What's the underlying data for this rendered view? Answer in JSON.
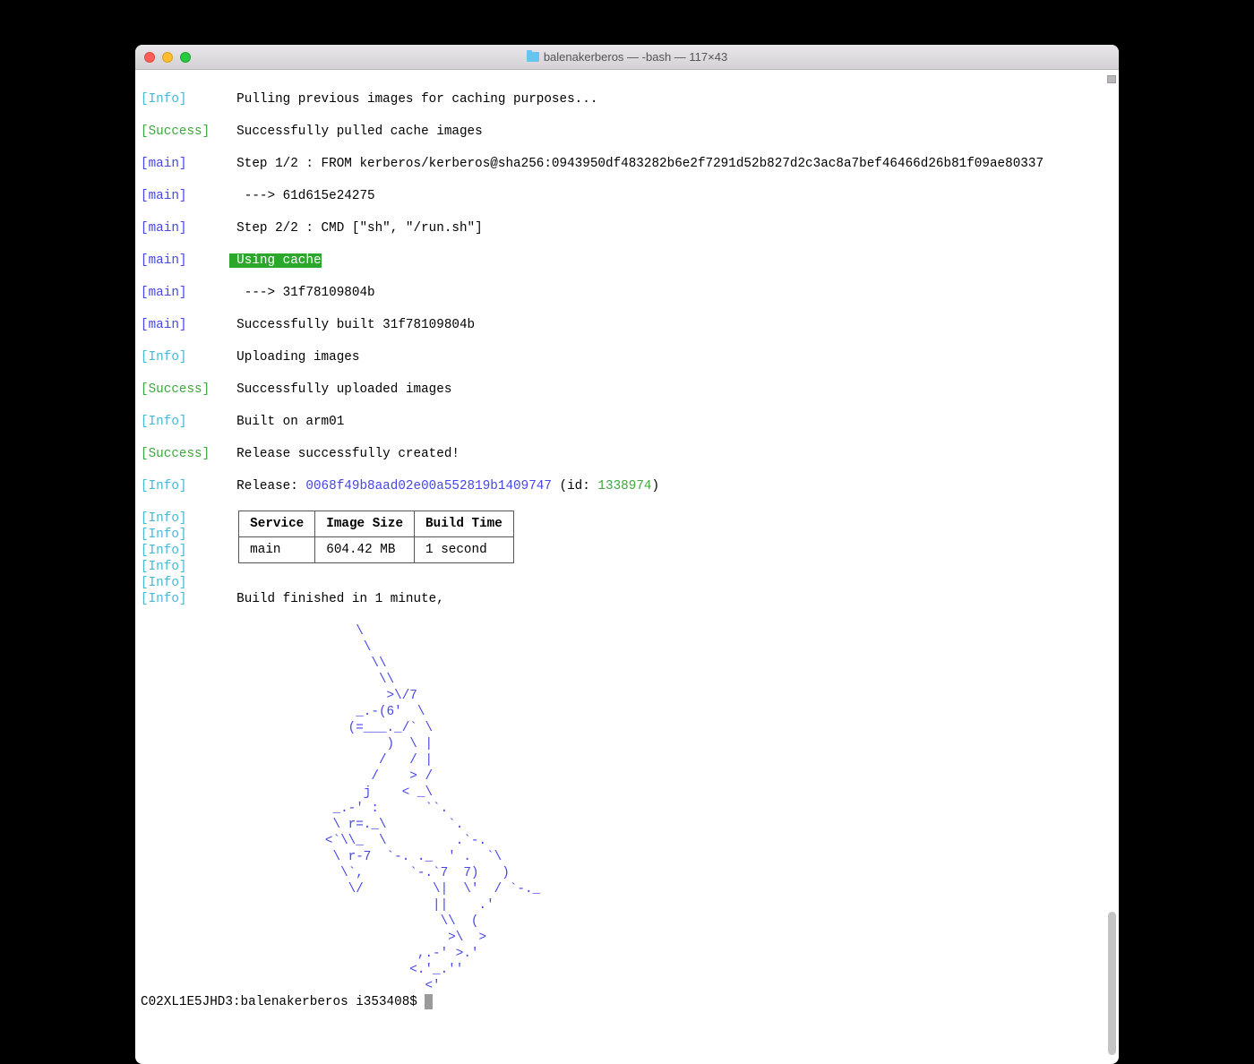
{
  "window": {
    "title": "balenakerberos — -bash — 117×43"
  },
  "tags": {
    "info": "[Info]",
    "success": "[Success]",
    "main": "[main]"
  },
  "lines": {
    "pulling": "Pulling previous images for caching purposes...",
    "pulled": "Successfully pulled cache images",
    "step1": "Step 1/2 : FROM kerberos/kerberos@sha256:0943950df483282b6e2f7291d52b827d2c3ac8a7bef46466d26b81f09ae80337",
    "arrow1": " ---> 61d615e24275",
    "step2": "Step 2/2 : CMD [\"sh\", \"/run.sh\"]",
    "usingcache": " Using cache",
    "arrow2": " ---> 31f78109804b",
    "built": "Successfully built 31f78109804b",
    "uploading": "Uploading images",
    "uploaded": "Successfully uploaded images",
    "builton": "Built on arm01",
    "relcreated": "Release successfully created!",
    "release_prefix": "Release: ",
    "release_hash": "0068f49b8aad02e00a552819b1409747",
    "release_mid": " (id: ",
    "release_id": "1338974",
    "release_end": ")",
    "finish": "Build finished in 1 minute,"
  },
  "table": {
    "h1": "Service",
    "h2": "Image Size",
    "h3": "Build Time",
    "r1c1": "main",
    "r1c2": "604.42 MB",
    "r1c3": "1 second"
  },
  "ascii": "                            \\\n                             \\\n                              \\\\\n                               \\\\\n                                >\\/7\n                            _.-(6'  \\\n                           (=___._/` \\\n                                )  \\ |\n                               /   / |\n                              /    > /\n                             j    < _\\\n                         _.-' :      ``.\n                         \\ r=._\\        `.\n                        <`\\\\_  \\         .`-.\n                         \\ r-7  `-. ._  ' .  `\\\n                          \\`,      `-.`7  7)   )\n                           \\/         \\|  \\'  / `-._\n                                      ||    .'\n                                       \\\\  (\n                                        >\\  >\n                                    ,.-' >.'\n                                   <.'_.''\n                                     <'",
  "prompt": "C02XL1E5JHD3:balenakerberos i353408$ "
}
